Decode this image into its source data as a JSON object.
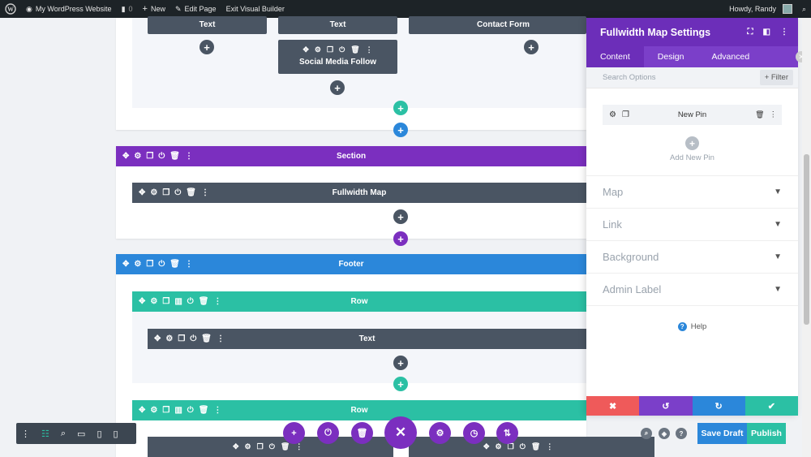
{
  "adminbar": {
    "site": "My WordPress Website",
    "comments": "0",
    "new": "New",
    "edit_page": "Edit Page",
    "exit": "Exit Visual Builder",
    "howdy": "Howdy, Randy"
  },
  "canvas": {
    "top_modules": {
      "left": "Text",
      "middle": "Text",
      "social": "Social Media Follow",
      "right": "Contact Form"
    },
    "section_title": "Section",
    "fullwidth_map": "Fullwidth Map",
    "footer_title": "Footer",
    "row1_title": "Row",
    "text_module": "Text",
    "row2_title": "Row"
  },
  "panel": {
    "title": "Fullwidth Map Settings",
    "tabs": [
      "Content",
      "Design",
      "Advanced"
    ],
    "search_placeholder": "Search Options",
    "filter": "+ Filter",
    "pin_title": "New Pin",
    "add_new_pin": "Add New Pin",
    "sections": [
      "Map",
      "Link",
      "Background",
      "Admin Label"
    ],
    "help": "Help"
  },
  "bottom": {
    "save_draft": "Save Draft",
    "publish": "Publish"
  },
  "colors": {
    "section": "#7b2fbf",
    "footer": "#2b87da",
    "row": "#2bc0a4",
    "module": "#4a5563",
    "cancel": "#ef5a5a",
    "undo": "#7b3fc9",
    "redo": "#2b87da",
    "save": "#2bc0a4"
  }
}
